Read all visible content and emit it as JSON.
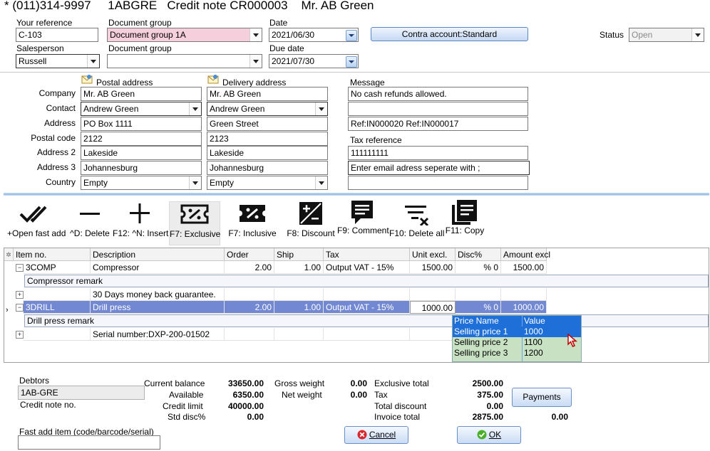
{
  "header": {
    "phone": "* (011)314-9997",
    "account": "1ABGRE",
    "doc_title": "Credit note CR000003",
    "customer": "Mr. AB Green"
  },
  "top_form": {
    "your_reference_label": "Your reference",
    "your_reference": "C-103",
    "document_group_label": "Document group",
    "document_group": "Document group 1A",
    "document_group2_label": "Document group",
    "document_group2": "",
    "date_label": "Date",
    "date": "2021/06/30",
    "due_date_label": "Due date",
    "due_date": "2021/07/30",
    "salesperson_label": "Salesperson",
    "salesperson": "Russell",
    "contra_button": "Contra account:Standard",
    "status_label": "Status",
    "status": "Open"
  },
  "address": {
    "postal_header": "Postal address",
    "delivery_header": "Delivery address",
    "message_header": "Message",
    "tax_reference_header": "Tax reference",
    "row_labels": [
      "Company",
      "Contact",
      "Address",
      "Postal code",
      "Address 2",
      "Address 3",
      "Country"
    ],
    "postal": [
      "Mr. AB Green",
      "Andrew Green",
      "PO Box 1111",
      "2122",
      "Lakeside",
      "Johannesburg",
      "Empty"
    ],
    "delivery": [
      "Mr. AB Green",
      "Andrew Green",
      "Green Street",
      "2123",
      "Lakeside",
      "Johannesburg",
      "Empty"
    ],
    "message_lines": [
      "No cash refunds allowed.",
      "",
      "Ref:IN000020 Ref:IN000017"
    ],
    "tax_reference": "111111111",
    "email_hint": "Enter email adress seperate with ;",
    "email_value": ""
  },
  "toolbar": [
    {
      "label": "+Open fast add",
      "icon": "double-check-icon"
    },
    {
      "label": "^D: Delete",
      "icon": "minus-icon"
    },
    {
      "label": "F12: ^N: Insert",
      "icon": "plus-icon"
    },
    {
      "label": "F7: Exclusive",
      "icon": "percent-ticket-outline-icon"
    },
    {
      "label": "F7: Inclusive",
      "icon": "percent-ticket-filled-icon"
    },
    {
      "label": "F8: Discount",
      "icon": "plus-minus-box-icon"
    },
    {
      "label": "F9: Comment",
      "icon": "comment-icon"
    },
    {
      "label": "F10: Delete all",
      "icon": "filter-remove-icon"
    },
    {
      "label": "F11: Copy",
      "icon": "copy-icon"
    }
  ],
  "grid": {
    "columns": [
      "Item no.",
      "Description",
      "Order",
      "Ship",
      "Tax",
      "Unit excl.",
      "Disc%",
      "Amount excl"
    ],
    "rows": [
      {
        "item": "3COMP",
        "desc": "Compressor",
        "order": "2.00",
        "ship": "1.00",
        "tax": "Output VAT - 15%",
        "unit": "1500.00",
        "disc": "% 0",
        "amount": "1500.00"
      },
      {
        "remark": "Compressor remark"
      },
      {
        "item": "",
        "desc": "30 Days money back guarantee.",
        "order": "",
        "ship": "",
        "tax": "",
        "unit": "",
        "disc": "",
        "amount": ""
      },
      {
        "item": "3DRILL",
        "desc": "Drill press",
        "order": "2.00",
        "ship": "1.00",
        "tax": "Output VAT - 15%",
        "unit": "1000.00",
        "disc": "% 0",
        "amount": "1000.00"
      },
      {
        "remark": "Drill press remark"
      },
      {
        "item": "",
        "desc": "Serial number:DXP-200-01502",
        "order": "",
        "ship": "",
        "tax": "",
        "unit": "",
        "disc": "",
        "amount": ""
      }
    ]
  },
  "price_popup": {
    "col1": "Price Name",
    "col2": "Value",
    "items": [
      {
        "name": "Selling price 1",
        "value": "1000"
      },
      {
        "name": "Selling price 2",
        "value": "1100"
      },
      {
        "name": "Selling price 3",
        "value": "1200"
      }
    ]
  },
  "footer": {
    "debtors_label": "Debtors",
    "debtors_value": "1AB-GRE",
    "credit_note_label": "Credit note no.",
    "fast_add_label": "Fast add item (code/barcode/serial)",
    "fast_add_value": "",
    "current_balance_label": "Current balance",
    "current_balance": "33650.00",
    "available_label": "Available",
    "available": "6350.00",
    "credit_limit_label": "Credit limit",
    "credit_limit": "40000.00",
    "std_disc_label": "Std disc%",
    "std_disc": "0.00",
    "gross_weight_label": "Gross weight",
    "gross_weight": "0.00",
    "net_weight_label": "Net weight",
    "net_weight": "0.00",
    "exclusive_total_label": "Exclusive total",
    "exclusive_total": "2500.00",
    "tax_label": "Tax",
    "tax": "375.00",
    "total_discount_label": "Total discount",
    "total_discount": "0.00",
    "invoice_total_label": "Invoice total",
    "invoice_total": "2875.00",
    "payments_button": "Payments",
    "payments_amount": "0.00",
    "cancel_button": "Cancel",
    "ok_button": "OK"
  }
}
